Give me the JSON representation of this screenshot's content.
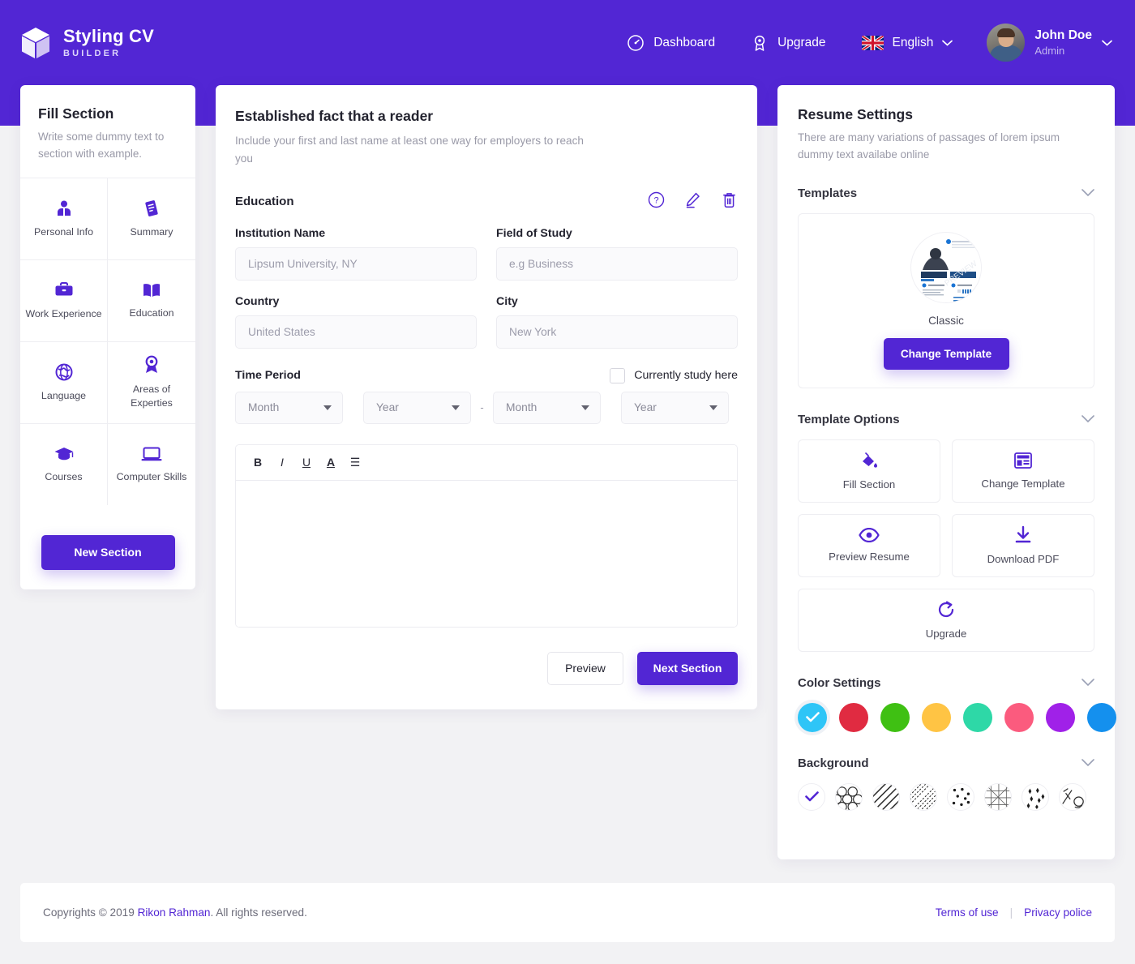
{
  "brand": {
    "title": "Styling CV",
    "subtitle": "BUILDER",
    "icon": "cube-icon"
  },
  "header": {
    "nav": [
      {
        "label": "Dashboard",
        "icon": "speedometer-icon"
      },
      {
        "label": "Upgrade",
        "icon": "award-icon"
      },
      {
        "label": "English",
        "icon": "uk-flag-icon"
      }
    ],
    "user": {
      "name": "John Doe",
      "role": "Admin"
    }
  },
  "left_panel": {
    "title": "Fill Section",
    "description": "Write some dummy text to section with example.",
    "sections": [
      {
        "label": "Personal Info",
        "icon": "user-icon"
      },
      {
        "label": "Summary",
        "icon": "document-icon"
      },
      {
        "label": "Work Experience",
        "icon": "briefcase-icon"
      },
      {
        "label": "Education",
        "icon": "book-icon"
      },
      {
        "label": "Language",
        "icon": "globe-icon"
      },
      {
        "label": "Areas of Experties",
        "icon": "ribbon-icon"
      },
      {
        "label": "Courses",
        "icon": "graduation-cap-icon"
      },
      {
        "label": "Computer Skills",
        "icon": "laptop-icon"
      }
    ],
    "new_section_label": "New Section"
  },
  "center_panel": {
    "title": "Established fact that a reader",
    "description": "Include your first and last name at least one way for employers to reach you",
    "subsection": {
      "title": "Education",
      "icons": [
        {
          "name": "help-icon"
        },
        {
          "name": "edit-icon"
        },
        {
          "name": "delete-icon"
        }
      ]
    },
    "fields": {
      "institution_label": "Institution Name",
      "institution_placeholder": "Lipsum University, NY",
      "institution_value": "",
      "field_of_study_label": "Field of Study",
      "field_of_study_placeholder": "e.g Business",
      "field_of_study_value": "",
      "country_label": "Country",
      "country_placeholder": "United States",
      "country_value": "",
      "city_label": "City",
      "city_placeholder": "New York",
      "city_value": ""
    },
    "time_period": {
      "label": "Time Period",
      "checkbox_label": "Currently study here",
      "checked": false,
      "start_month": "Month",
      "start_year": "Year",
      "separator": "-",
      "end_month": "Month",
      "end_year": "Year"
    },
    "editor": {
      "tools": [
        {
          "name": "bold-icon",
          "glyph": "B"
        },
        {
          "name": "italic-icon",
          "glyph": "I"
        },
        {
          "name": "underline-icon",
          "glyph": "U"
        },
        {
          "name": "font-color-icon",
          "glyph": "A"
        },
        {
          "name": "list-icon",
          "glyph": "☰"
        }
      ],
      "content": ""
    },
    "buttons": {
      "preview": "Preview",
      "next": "Next Section"
    }
  },
  "right_panel": {
    "title": "Resume Settings",
    "description": "There are many variations of passages of lorem ipsum dummy text availabe online",
    "templates": {
      "section_label": "Templates",
      "selected_name": "Classic",
      "change_label": "Change Template"
    },
    "template_options": {
      "section_label": "Template Options",
      "items": [
        {
          "label": "Fill Section",
          "icon": "paint-bucket-icon"
        },
        {
          "label": "Change Template",
          "icon": "layout-icon"
        },
        {
          "label": "Preview Resume",
          "icon": "eye-icon"
        },
        {
          "label": "Download PDF",
          "icon": "download-icon"
        },
        {
          "label": "Upgrade",
          "icon": "refresh-icon"
        }
      ]
    },
    "color_settings": {
      "section_label": "Color Settings",
      "selected_index": 0,
      "colors": [
        "#2ec5f7",
        "#e02b41",
        "#3fc013",
        "#ffc444",
        "#2ed8a7",
        "#fb5b7e",
        "#a021e8",
        "#1490ee"
      ]
    },
    "background": {
      "section_label": "Background",
      "selected_index": 0,
      "patterns": [
        "none",
        "scales",
        "diagonal-lines",
        "dense-diagonal",
        "dots",
        "mesh",
        "diamonds",
        "abstract"
      ]
    }
  },
  "footer": {
    "copyright_pre": "Copyrights © 2019 ",
    "copyright_link": "Rikon Rahman",
    "copyright_post": ". All rights reserved.",
    "terms": "Terms of use",
    "separator": "|",
    "privacy": "Privacy police"
  },
  "theme": {
    "primary": "#5226d4",
    "page_bg": "#f2f2f4",
    "link": "#5226d4"
  }
}
